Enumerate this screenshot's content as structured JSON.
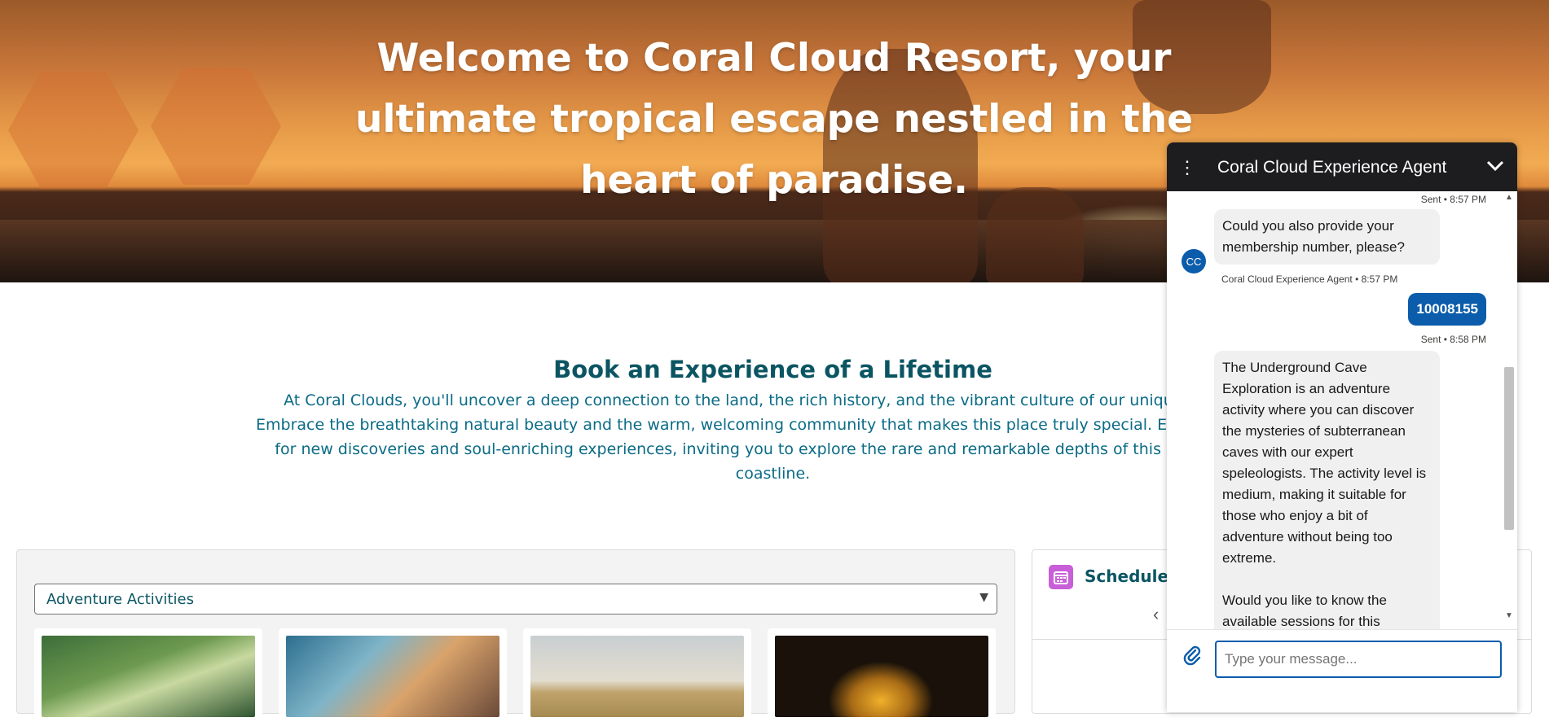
{
  "hero": {
    "title": "Welcome to Coral Cloud Resort, your ultimate tropical escape nestled in the heart of paradise."
  },
  "intro": {
    "title": "Book an Experience of a Lifetime",
    "text": "At Coral Clouds, you'll uncover a deep connection to the land, the rich history, and the vibrant culture of our unique coastline. Embrace the breathtaking natural beauty and the warm, welcoming community that makes this place truly special. Each opportunity for new discoveries and soul-enriching experiences, inviting you to explore the rare and remarkable depths of this extraordinary coastline."
  },
  "activities": {
    "selected_category": "Adventure Activities",
    "cards": [
      {
        "icon": "zipline-photo"
      },
      {
        "icon": "rock-climbing-photo"
      },
      {
        "icon": "safari-jeep-photo"
      },
      {
        "icon": "cave-photo"
      }
    ]
  },
  "schedule": {
    "title": "Schedule",
    "icon": "calendar-icon",
    "icon_color": "#c95fd8"
  },
  "chat": {
    "header_title": "Coral Cloud Experience Agent",
    "header_bg": "#1d1d1f",
    "avatar_initials": "CC",
    "messages": [
      {
        "meta": "Sent • 8:57 PM"
      },
      {
        "text": "Could you also provide your membership number, please?",
        "meta": "Coral Cloud Experience Agent • 8:57 PM"
      },
      {
        "text": "10008155",
        "meta": "Sent • 8:58 PM"
      },
      {
        "text": "The Underground Cave Exploration is an adventure activity where you can discover the mysteries of subterranean caves with our expert speleologists. The activity level is medium, making it suitable for those who enjoy a bit of adventure without being too extreme.",
        "text2": "Would you like to know the available sessions for this"
      }
    ],
    "input_placeholder": "Type your message...",
    "accent_color": "#0b5cab"
  }
}
